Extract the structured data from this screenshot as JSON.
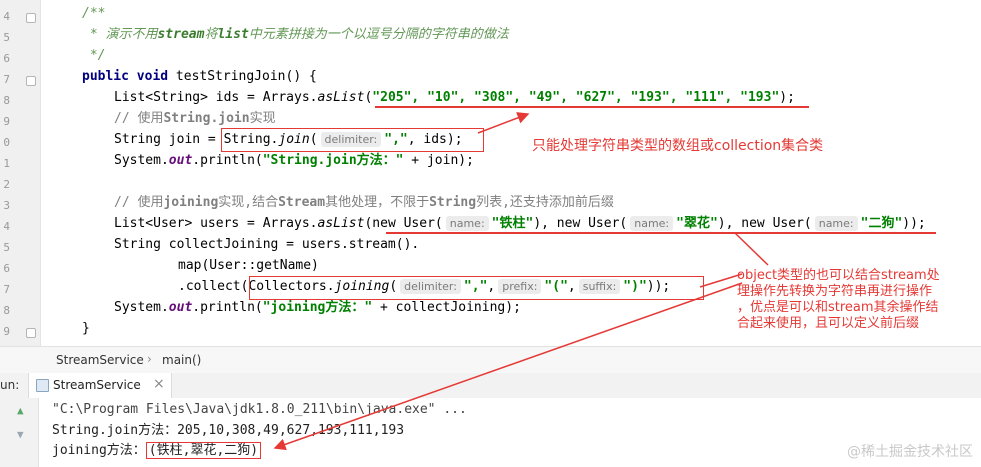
{
  "editor": {
    "line_numbers": [
      "4",
      "5",
      "6",
      "7",
      "8",
      "9",
      "0",
      "1",
      "2",
      "3",
      "4",
      "5",
      "6",
      "7",
      "8",
      "9"
    ],
    "code": {
      "l1": "/**",
      "l2a": " * 演示不用",
      "l2b": "stream",
      "l2c": "将",
      "l2d": "list",
      "l2e": "中元素拼接为一个以逗号分隔的字符串的做法",
      "l3": " */",
      "l4_kw": "public void",
      "l4_rest": " testStringJoin() {",
      "l5_a": "List<String> ids = Arrays.",
      "l5_b": "asList",
      "l5_c": "(",
      "l5_str": "\"205\", \"10\", \"308\", \"49\", \"627\", \"193\", \"111\", \"193\"",
      "l5_d": ");",
      "l6_a": "// 使用",
      "l6_b": "String.join",
      "l6_c": "实现",
      "l7_a": "String join = ",
      "l7_b": "String.",
      "l7_c": "join",
      "l7_d": "(",
      "l7_hint": "delimiter:",
      "l7_str": "\",\"",
      "l7_e": ", ids);",
      "l8_a": "System.",
      "l8_b": "out",
      "l8_c": ".println(",
      "l8_str": "\"String.join方法：\"",
      "l8_d": " + join);",
      "l10_a": "// 使用",
      "l10_b": "joining",
      "l10_c": "实现,结合",
      "l10_d": "Stream",
      "l10_e": "其他处理，不限于",
      "l10_f": "String",
      "l10_g": "列表,还支持添加前后缀",
      "l11_a": "List<User> users = Arrays.",
      "l11_b": "asList",
      "l11_c": "(new User(",
      "l11_h1": "name:",
      "l11_s1": "\"铁柱\"",
      "l11_d": "), new User(",
      "l11_h2": "name:",
      "l11_s2": "\"翠花\"",
      "l11_e": "), new User(",
      "l11_h3": "name:",
      "l11_s3": "\"二狗\"",
      "l11_f": "));",
      "l12": "String collectJoining = users.stream().",
      "l13": "map(User::getName)",
      "l14_a": ".collect(",
      "l14_b": "Collectors.",
      "l14_c": "joining",
      "l14_d": "(",
      "l14_h1": "delimiter:",
      "l14_s1": "\",\"",
      "l14_e": ",",
      "l14_h2": "prefix:",
      "l14_s2": "\"(\"",
      "l14_f": ",",
      "l14_h3": "suffix:",
      "l14_s3": "\")\"",
      "l14_g": "));",
      "l15_a": "System.",
      "l15_b": "out",
      "l15_c": ".println(",
      "l15_str": "\"joining方法：\"",
      "l15_d": " + collectJoining);",
      "l16": "}"
    }
  },
  "annotations": {
    "note1": "只能处理字符串类型的数组或collection集合类",
    "note2_lines": [
      "object类型的也可以结合stream处",
      "理操作先转换为字符串再进行操作",
      "，优点是可以和stream其余操作结",
      "合起来使用，且可以定义前后缀"
    ]
  },
  "breadcrumb": {
    "class": "StreamService",
    "method": "main()"
  },
  "run": {
    "label": "un:",
    "tab": "StreamService",
    "close": "×"
  },
  "console": {
    "cmd": "\"C:\\Program Files\\Java\\jdk1.8.0_211\\bin\\java.exe\" ...",
    "out1": "String.join方法：205,10,308,49,627,193,111,193",
    "out2_label": "joining方法：",
    "out2_value": "(铁柱,翠花,二狗)"
  },
  "watermark": "@稀土掘金技术社区",
  "colors": {
    "annotation": "#e53935",
    "keyword": "#000080",
    "string": "#008000",
    "comment": "#808080"
  }
}
